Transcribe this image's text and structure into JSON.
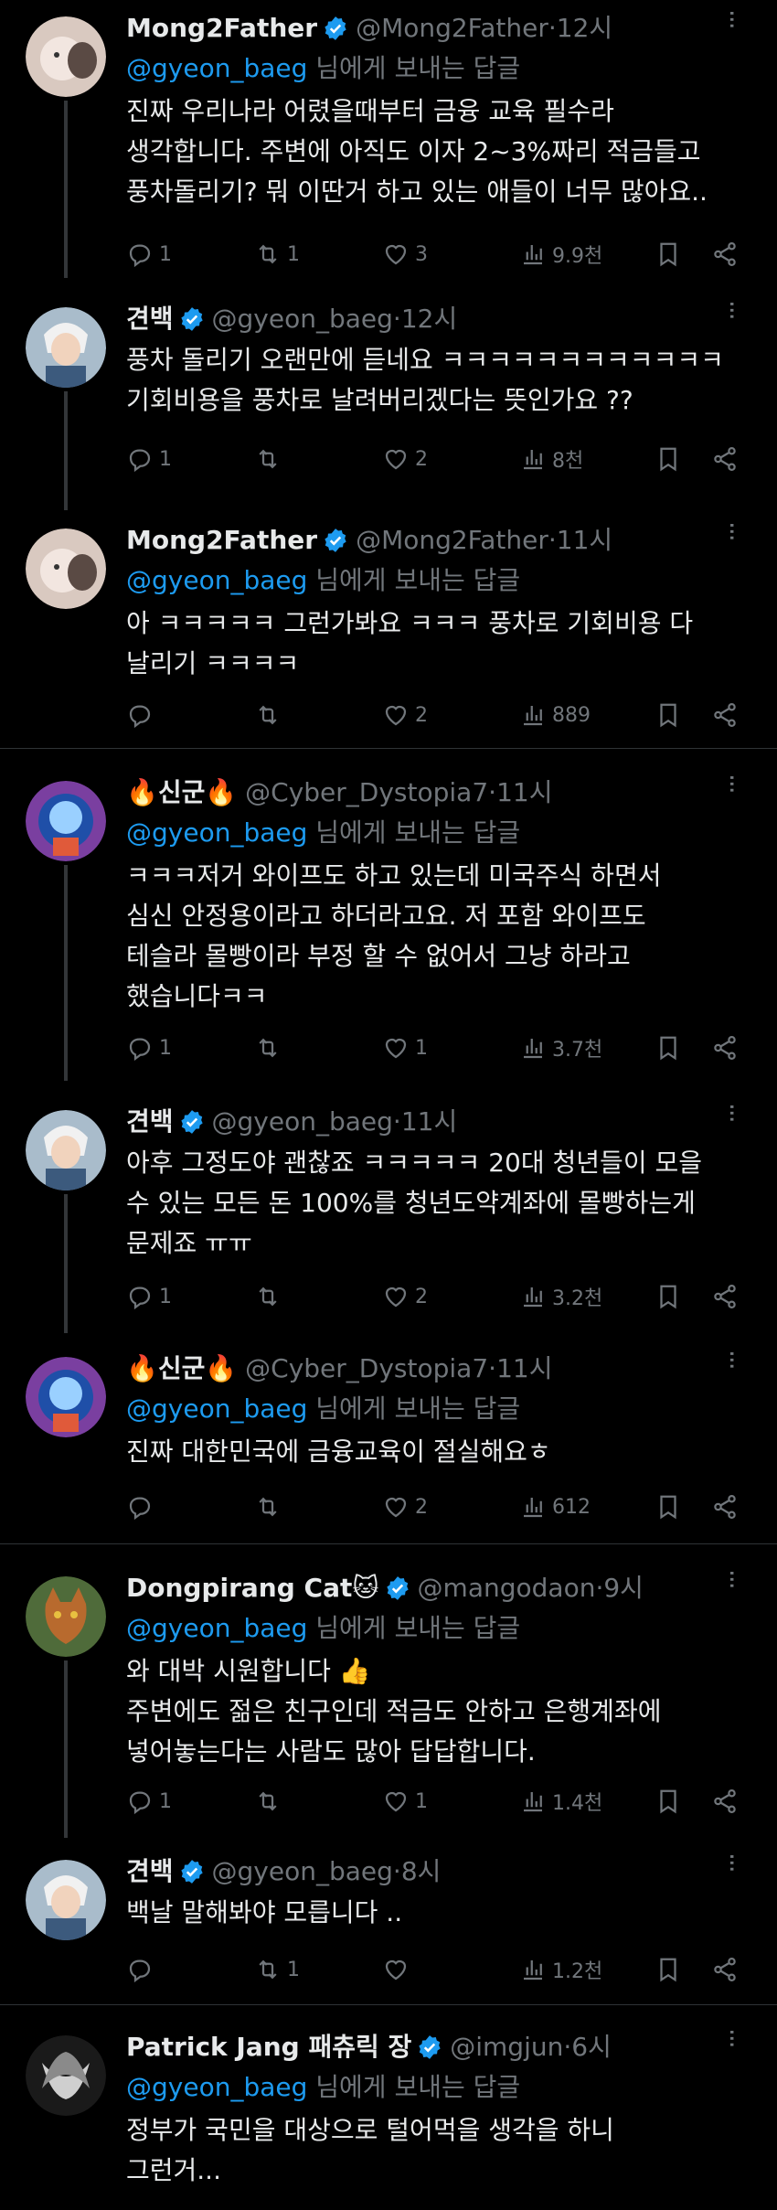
{
  "tweets": [
    {
      "name": "Mong2Father",
      "handle": "@Mong2Father",
      "time": "12시",
      "reply_to": "@gyeon_baeg",
      "reply_suffix": " 님에게 보내는 답글",
      "text": "진짜 우리나라 어렸을때부터 금융 교육 필수라\n생각합니다. 주변에 아직도 이자 2~3%짜리 적금들고\n풍차돌리기? 뭐 이딴거 하고 있는 애들이 너무 많아요..",
      "replies": "1",
      "retweets": "1",
      "likes": "3",
      "views": "9.9천",
      "avatar": "mong"
    },
    {
      "name": "견백",
      "handle": "@gyeon_baeg",
      "time": "12시",
      "text": "풍차 돌리기 오랜만에 듣네요 ㅋㅋㅋㅋㅋㅋㅋㅋㅋㅋㅋㅋ\n기회비용을 풍차로 날려버리겠다는 뜻인가요 ??",
      "replies": "1",
      "retweets": "",
      "likes": "2",
      "views": "8천",
      "avatar": "gyeon"
    },
    {
      "name": "Mong2Father",
      "handle": "@Mong2Father",
      "time": "11시",
      "reply_to": "@gyeon_baeg",
      "reply_suffix": " 님에게 보내는 답글",
      "text": "아 ㅋㅋㅋㅋㅋ 그런가봐요 ㅋㅋㅋ 풍차로 기회비용 다\n날리기 ㅋㅋㅋㅋ",
      "replies": "",
      "retweets": "",
      "likes": "2",
      "views": "889",
      "avatar": "mong"
    },
    {
      "name": "🔥신군🔥",
      "handle": "@Cyber_Dystopia7",
      "time": "11시",
      "reply_to": "@gyeon_baeg",
      "reply_suffix": " 님에게 보내는 답글",
      "text": "ㅋㅋㅋ저거 와이프도 하고 있는데 미국주식 하면서\n심신 안정용이라고 하더라고요. 저 포함 와이프도\n테슬라 몰빵이라 부정 할 수 없어서 그냥 하라고\n했습니다ㅋㅋ",
      "replies": "1",
      "retweets": "",
      "likes": "1",
      "views": "3.7천",
      "avatar": "cyber"
    },
    {
      "name": "견백",
      "handle": "@gyeon_baeg",
      "time": "11시",
      "text": "아후 그정도야 괜찮죠 ㅋㅋㅋㅋㅋ 20대 청년들이 모을\n수 있는 모든 돈 100%를 청년도약계좌에 몰빵하는게\n문제죠 ㅠㅠ",
      "replies": "1",
      "retweets": "",
      "likes": "2",
      "views": "3.2천",
      "avatar": "gyeon"
    },
    {
      "name": "🔥신군🔥",
      "handle": "@Cyber_Dystopia7",
      "time": "11시",
      "reply_to": "@gyeon_baeg",
      "reply_suffix": " 님에게 보내는 답글",
      "text": "진짜 대한민국에 금융교육이 절실해요ㅎ",
      "replies": "",
      "retweets": "",
      "likes": "2",
      "views": "612",
      "avatar": "cyber"
    },
    {
      "name": "Dongpirang Cat🐱",
      "handle": "@mangodaon",
      "time": "9시",
      "reply_to": "@gyeon_baeg",
      "reply_suffix": " 님에게 보내는 답글",
      "text": "와 대박 시원합니다 👍\n주변에도 젊은 친구인데 적금도 안하고 은행계좌에\n넣어놓는다는 사람도 많아 답답합니다.",
      "replies": "1",
      "retweets": "",
      "likes": "1",
      "views": "1.4천",
      "avatar": "cat"
    },
    {
      "name": "견백",
      "handle": "@gyeon_baeg",
      "time": "8시",
      "text": "백날 말해봐야 모릅니다 ..",
      "replies": "",
      "retweets": "1",
      "likes": "",
      "views": "1.2천",
      "avatar": "gyeon"
    },
    {
      "name": "Patrick Jang 패츄릭 장",
      "handle": "@imgjun",
      "time": "6시",
      "reply_to": "@gyeon_baeg",
      "reply_suffix": " 님에게 보내는 답글",
      "text": "정부가 국민을 대상으로 털어먹을 생각을 하니\n그런거...",
      "avatar": "patrick"
    }
  ],
  "ui": {
    "dot": "·",
    "more": "···"
  },
  "colors": {
    "background": "#000000",
    "text": "#e7e9ea",
    "muted": "#71767b",
    "link": "#1d9bf0",
    "verified": "#1d9bf0"
  },
  "icons": [
    "reply-icon",
    "retweet-icon",
    "like-icon",
    "views-icon",
    "bookmark-icon",
    "share-icon",
    "verified-badge-icon",
    "more-icon"
  ]
}
